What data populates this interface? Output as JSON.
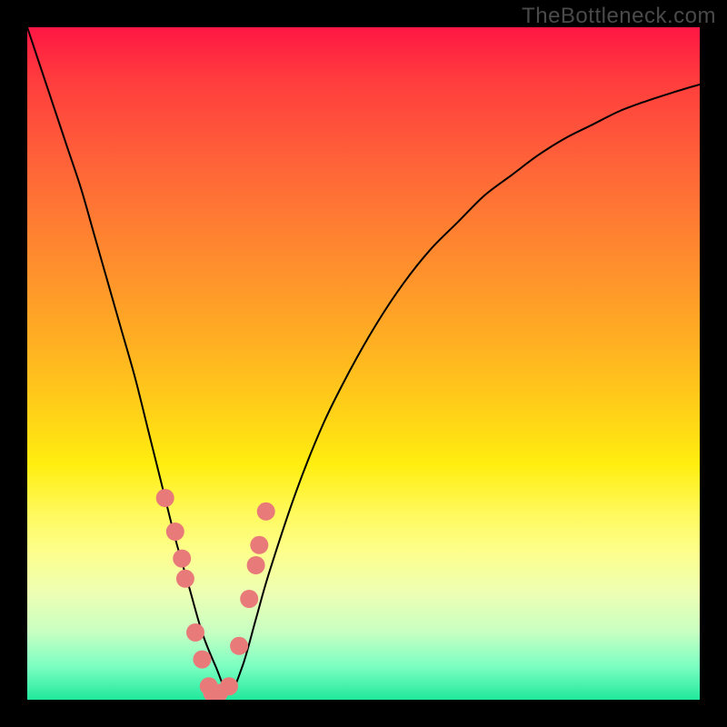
{
  "watermark": "TheBottleneck.com",
  "chart_data": {
    "type": "line",
    "title": "",
    "xlabel": "",
    "ylabel": "",
    "xlim": [
      0,
      100
    ],
    "ylim": [
      0,
      100
    ],
    "series": [
      {
        "name": "bottleneck-curve",
        "x": [
          0,
          2,
          4,
          6,
          8,
          10,
          12,
          14,
          16,
          18,
          20,
          22,
          24,
          26,
          28,
          30,
          32,
          34,
          36,
          40,
          44,
          48,
          52,
          56,
          60,
          64,
          68,
          72,
          76,
          80,
          84,
          88,
          92,
          96,
          100
        ],
        "y": [
          100,
          94,
          88,
          82,
          76,
          69,
          62,
          55,
          48,
          40,
          32,
          24,
          17,
          10,
          5,
          1,
          5,
          12,
          19,
          31,
          41,
          49,
          56,
          62,
          67,
          71,
          75,
          78,
          81,
          83.5,
          85.5,
          87.5,
          89,
          90.3,
          91.5
        ]
      }
    ],
    "markers": {
      "name": "highlighted-points",
      "color": "#e97a7a",
      "x": [
        20.5,
        22,
        23,
        23.5,
        25,
        26,
        27,
        27.5,
        28.5,
        30,
        31.5,
        33,
        34,
        34.5,
        35.5
      ],
      "y": [
        30,
        25,
        21,
        18,
        10,
        6,
        2,
        1,
        1,
        2,
        8,
        15,
        20,
        23,
        28
      ]
    }
  }
}
